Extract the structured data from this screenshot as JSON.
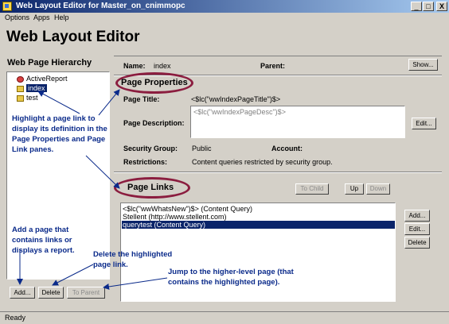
{
  "window": {
    "title": "Web Layout Editor for Master_on_cnimmopc",
    "minimize": "_",
    "maximize": "□",
    "close": "X"
  },
  "menu": [
    "Options",
    "Apps",
    "Help"
  ],
  "app_title": "Web Layout Editor",
  "hierarchy": {
    "title": "Web Page Hierarchy",
    "items": [
      "ActiveReport",
      "index",
      "test"
    ],
    "buttons": {
      "add": "Add...",
      "delete": "Delete",
      "to_parent": "To Parent"
    }
  },
  "header": {
    "name_label": "Name:",
    "name_value": "index",
    "parent_label": "Parent:",
    "show_button": "Show..."
  },
  "page_properties": {
    "title": "Page Properties",
    "page_title_label": "Page Title:",
    "page_title_value": "<$lc(\"wwIndexPageTitle\")$>",
    "page_description_label": "Page Description:",
    "page_description_value": "<$lc(\"wwIndexPageDesc\")$>",
    "edit_button": "Edit...",
    "security_group_label": "Security Group:",
    "security_group_value": "Public",
    "account_label": "Account:",
    "restrictions_label": "Restrictions:",
    "restrictions_value": "Content queries restricted by security group."
  },
  "page_links": {
    "title": "Page Links",
    "to_child_button": "To Child",
    "up_button": "Up",
    "down_button": "Down",
    "items": [
      "<$lc(\"wwWhatsNew\")$> (Content Query)",
      "Stellent (http://www.stellent.com)",
      "querytest (Content Query)"
    ],
    "buttons": {
      "add": "Add...",
      "edit": "Edit...",
      "delete": "Delete"
    }
  },
  "callouts": {
    "highlight": "Highlight a page link to display its definition in the Page Properties and Page Link panes.",
    "add_page": "Add a page that contains links or displays a report.",
    "delete": "Delete the highlighted page link.",
    "jump": "Jump to the higher-level page (that contains the highlighted page)."
  },
  "status": "Ready",
  "colors": {
    "titlebar_start": "#0a246a",
    "titlebar_end": "#a6caf0",
    "callout_text": "#0a2a8a",
    "oval": "#8b1d3f",
    "selection": "#0a246a"
  }
}
